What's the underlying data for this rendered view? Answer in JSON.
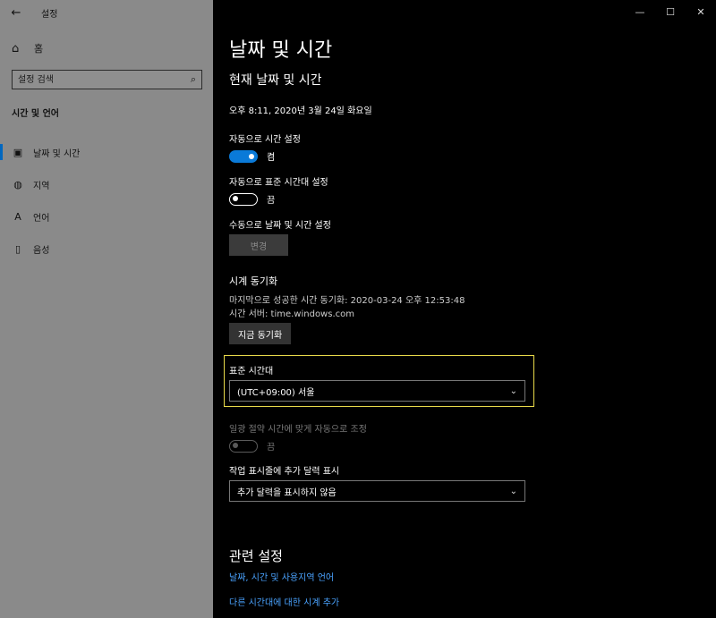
{
  "window": {
    "title": "설정",
    "controls": {
      "minimize": "—",
      "maximize": "☐",
      "close": "✕"
    }
  },
  "sidebar": {
    "home_label": "홈",
    "search_placeholder": "설정 검색",
    "section": "시간 및 언어",
    "items": [
      {
        "label": "날짜 및 시간",
        "icon": "calendar-clock-icon",
        "glyph": "▣",
        "selected": true
      },
      {
        "label": "지역",
        "icon": "globe-icon",
        "glyph": "◍",
        "selected": false
      },
      {
        "label": "언어",
        "icon": "language-icon",
        "glyph": "A",
        "selected": false
      },
      {
        "label": "음성",
        "icon": "microphone-icon",
        "glyph": "▯",
        "selected": false
      }
    ]
  },
  "main": {
    "page_title": "날짜 및 시간",
    "sub_title": "현재 날짜 및 시간",
    "current_datetime": "오후 8:11, 2020년 3월 24일 화요일",
    "auto_time": {
      "label": "자동으로 시간 설정",
      "state": "켬",
      "on": true
    },
    "auto_timezone": {
      "label": "자동으로 표준 시간대 설정",
      "state": "끔",
      "on": false
    },
    "manual": {
      "label": "수동으로 날짜 및 시간 설정",
      "button": "변경"
    },
    "sync": {
      "title": "시계 동기화",
      "last_sync": "마지막으로 성공한 시간 동기화: 2020-03-24 오후 12:53:48",
      "server": "시간 서버: time.windows.com",
      "button": "지금 동기화"
    },
    "timezone": {
      "label": "표준 시간대",
      "value": "(UTC+09:00) 서울"
    },
    "dst": {
      "label": "일광 절약 시간에 맞게 자동으로 조정",
      "state": "끔"
    },
    "calendar": {
      "label": "작업 표시줄에 추가 달력 표시",
      "value": "추가 달력을 표시하지 않음"
    },
    "related": {
      "title": "관련 설정",
      "links": [
        "날짜, 시간 및 사용지역 언어",
        "다른 시간대에 대한 시계 추가"
      ]
    }
  },
  "colors": {
    "accent": "#0a7ad8",
    "highlight": "#e8d94a",
    "link": "#4aa3ff",
    "sidebar_bg": "#8a8a8a"
  }
}
